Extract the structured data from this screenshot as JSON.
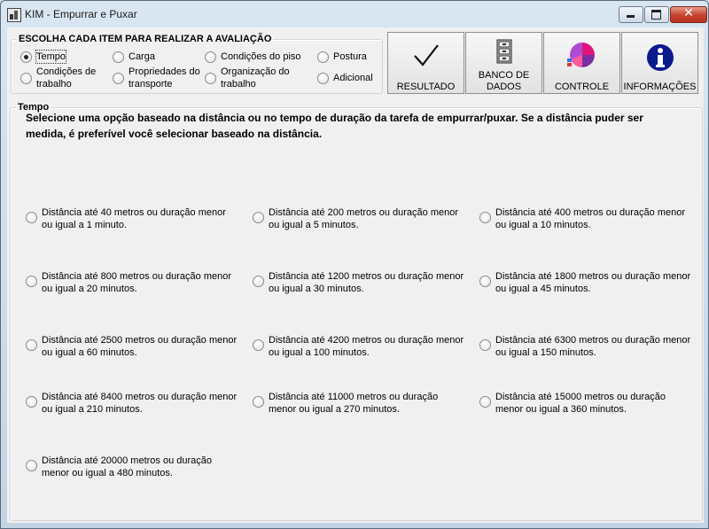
{
  "window": {
    "title": "KIM - Empurrar e Puxar",
    "close_glyph": "✕"
  },
  "choose_section": {
    "title": "ESCOLHA CADA ITEM PARA REALIZAR A AVALIAÇÃO",
    "items": [
      {
        "label": "Tempo",
        "selected": true
      },
      {
        "label": "Carga",
        "selected": false
      },
      {
        "label": "Condições do piso",
        "selected": false
      },
      {
        "label": "Postura",
        "selected": false
      },
      {
        "label": "Condições de trabalho",
        "selected": false
      },
      {
        "label": "Propriedades do transporte",
        "selected": false
      },
      {
        "label": "Organização do trabalho",
        "selected": false
      },
      {
        "label": "Adicional",
        "selected": false
      }
    ]
  },
  "toolbar": [
    {
      "label": "RESULTADO",
      "icon": "checkmark-icon"
    },
    {
      "label": "BANCO DE DADOS",
      "icon": "file-cabinet-icon"
    },
    {
      "label": "CONTROLE",
      "icon": "pie-chart-icon"
    },
    {
      "label": "INFORMAÇÕES",
      "icon": "info-icon"
    }
  ],
  "time_section": {
    "title": "Tempo",
    "instruction": "Selecione uma opção baseado na distância ou no tempo de duração da tarefa de empurrar/puxar. Se a distância puder ser medida, é preferível você selecionar baseado na distância.",
    "options": [
      "Distância até 40 metros ou duração menor ou igual a 1 minuto.",
      "Distância até 200 metros ou duração menor ou igual a 5 minutos.",
      "Distância até 400 metros ou duração menor ou igual a 10 minutos.",
      "Distância até 800 metros ou duração menor ou igual a 20 minutos.",
      "Distância até 1200 metros ou duração menor ou igual a 30 minutos.",
      "Distância até 1800 metros ou duração menor ou igual a 45 minutos.",
      "Distância até 2500 metros ou duração menor ou igual a 60 minutos.",
      "Distância até 4200 metros ou duração menor ou igual a 100 minutos.",
      "Distância até 6300 metros ou duração menor ou igual a 150 minutos.",
      "Distância até 8400 metros ou duração menor ou igual a 210 minutos.",
      "Distância até 11000 metros ou duração menor ou igual a 270 minutos.",
      "Distância até 15000 metros ou duração menor ou igual a 360 minutos.",
      "Distância até 20000 metros ou duração menor ou igual a 480 minutos."
    ]
  }
}
